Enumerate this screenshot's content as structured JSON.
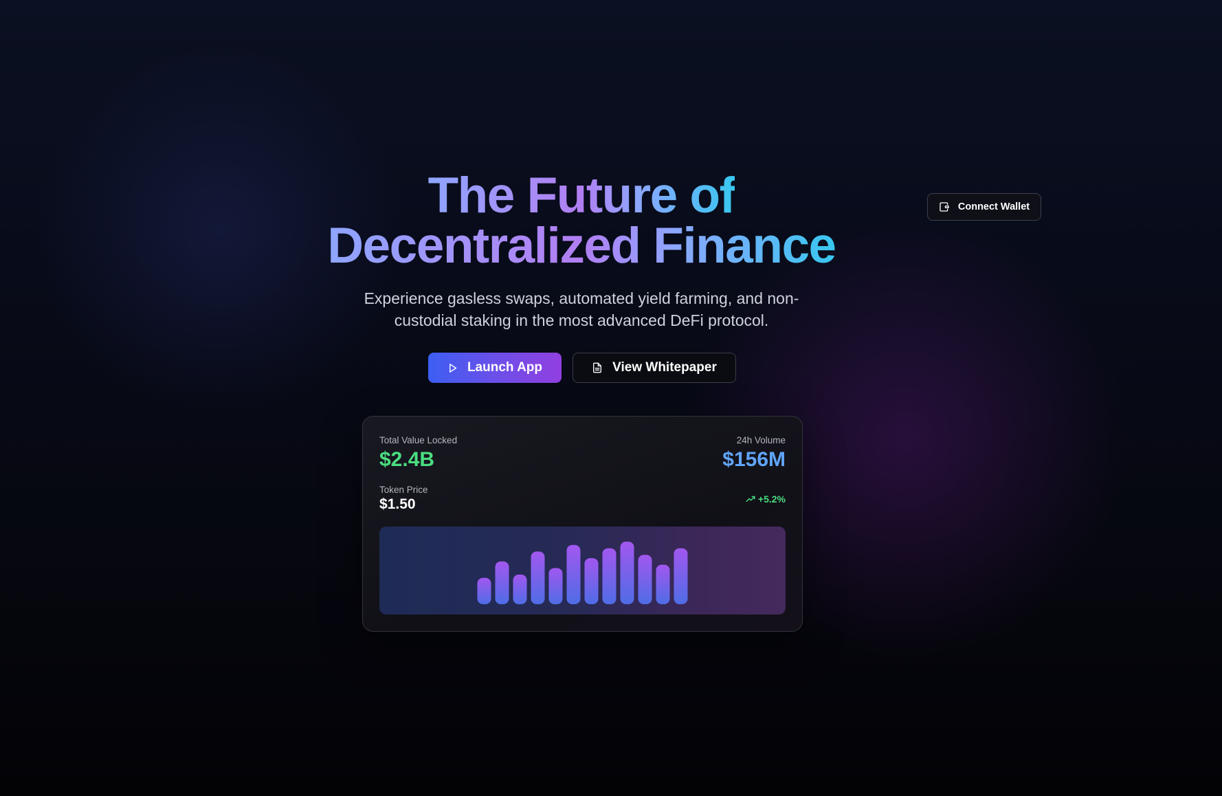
{
  "header": {
    "connect_wallet_label": "Connect Wallet",
    "connect_wallet_icon": "wallet-icon"
  },
  "hero": {
    "title_line1": "The Future of",
    "title_line2": "Decentralized Finance",
    "subtitle": "Experience gasless swaps, automated yield farming, and non-custodial staking in the most advanced DeFi protocol.",
    "launch_app_label": "Launch App",
    "launch_app_icon": "play-icon",
    "whitepaper_label": "View Whitepaper",
    "whitepaper_icon": "document-icon"
  },
  "stats": {
    "tvl_label": "Total Value Locked",
    "tvl_value": "$2.4B",
    "volume_label": "24h Volume",
    "volume_value": "$156M",
    "price_label": "Token Price",
    "price_value": "$1.50",
    "change": "+5.2%",
    "change_icon": "trending-up-icon"
  },
  "colors": {
    "positive": "#4ade80",
    "volume": "#60a5fa",
    "primary_gradient_start": "#3d5ef2",
    "primary_gradient_end": "#913fe0",
    "bar_top": "#a257ef",
    "bar_bottom": "#4f6de6"
  },
  "chart_data": {
    "type": "bar",
    "values": [
      40,
      65,
      45,
      80,
      55,
      90,
      70,
      85,
      95,
      75,
      60,
      85
    ]
  }
}
